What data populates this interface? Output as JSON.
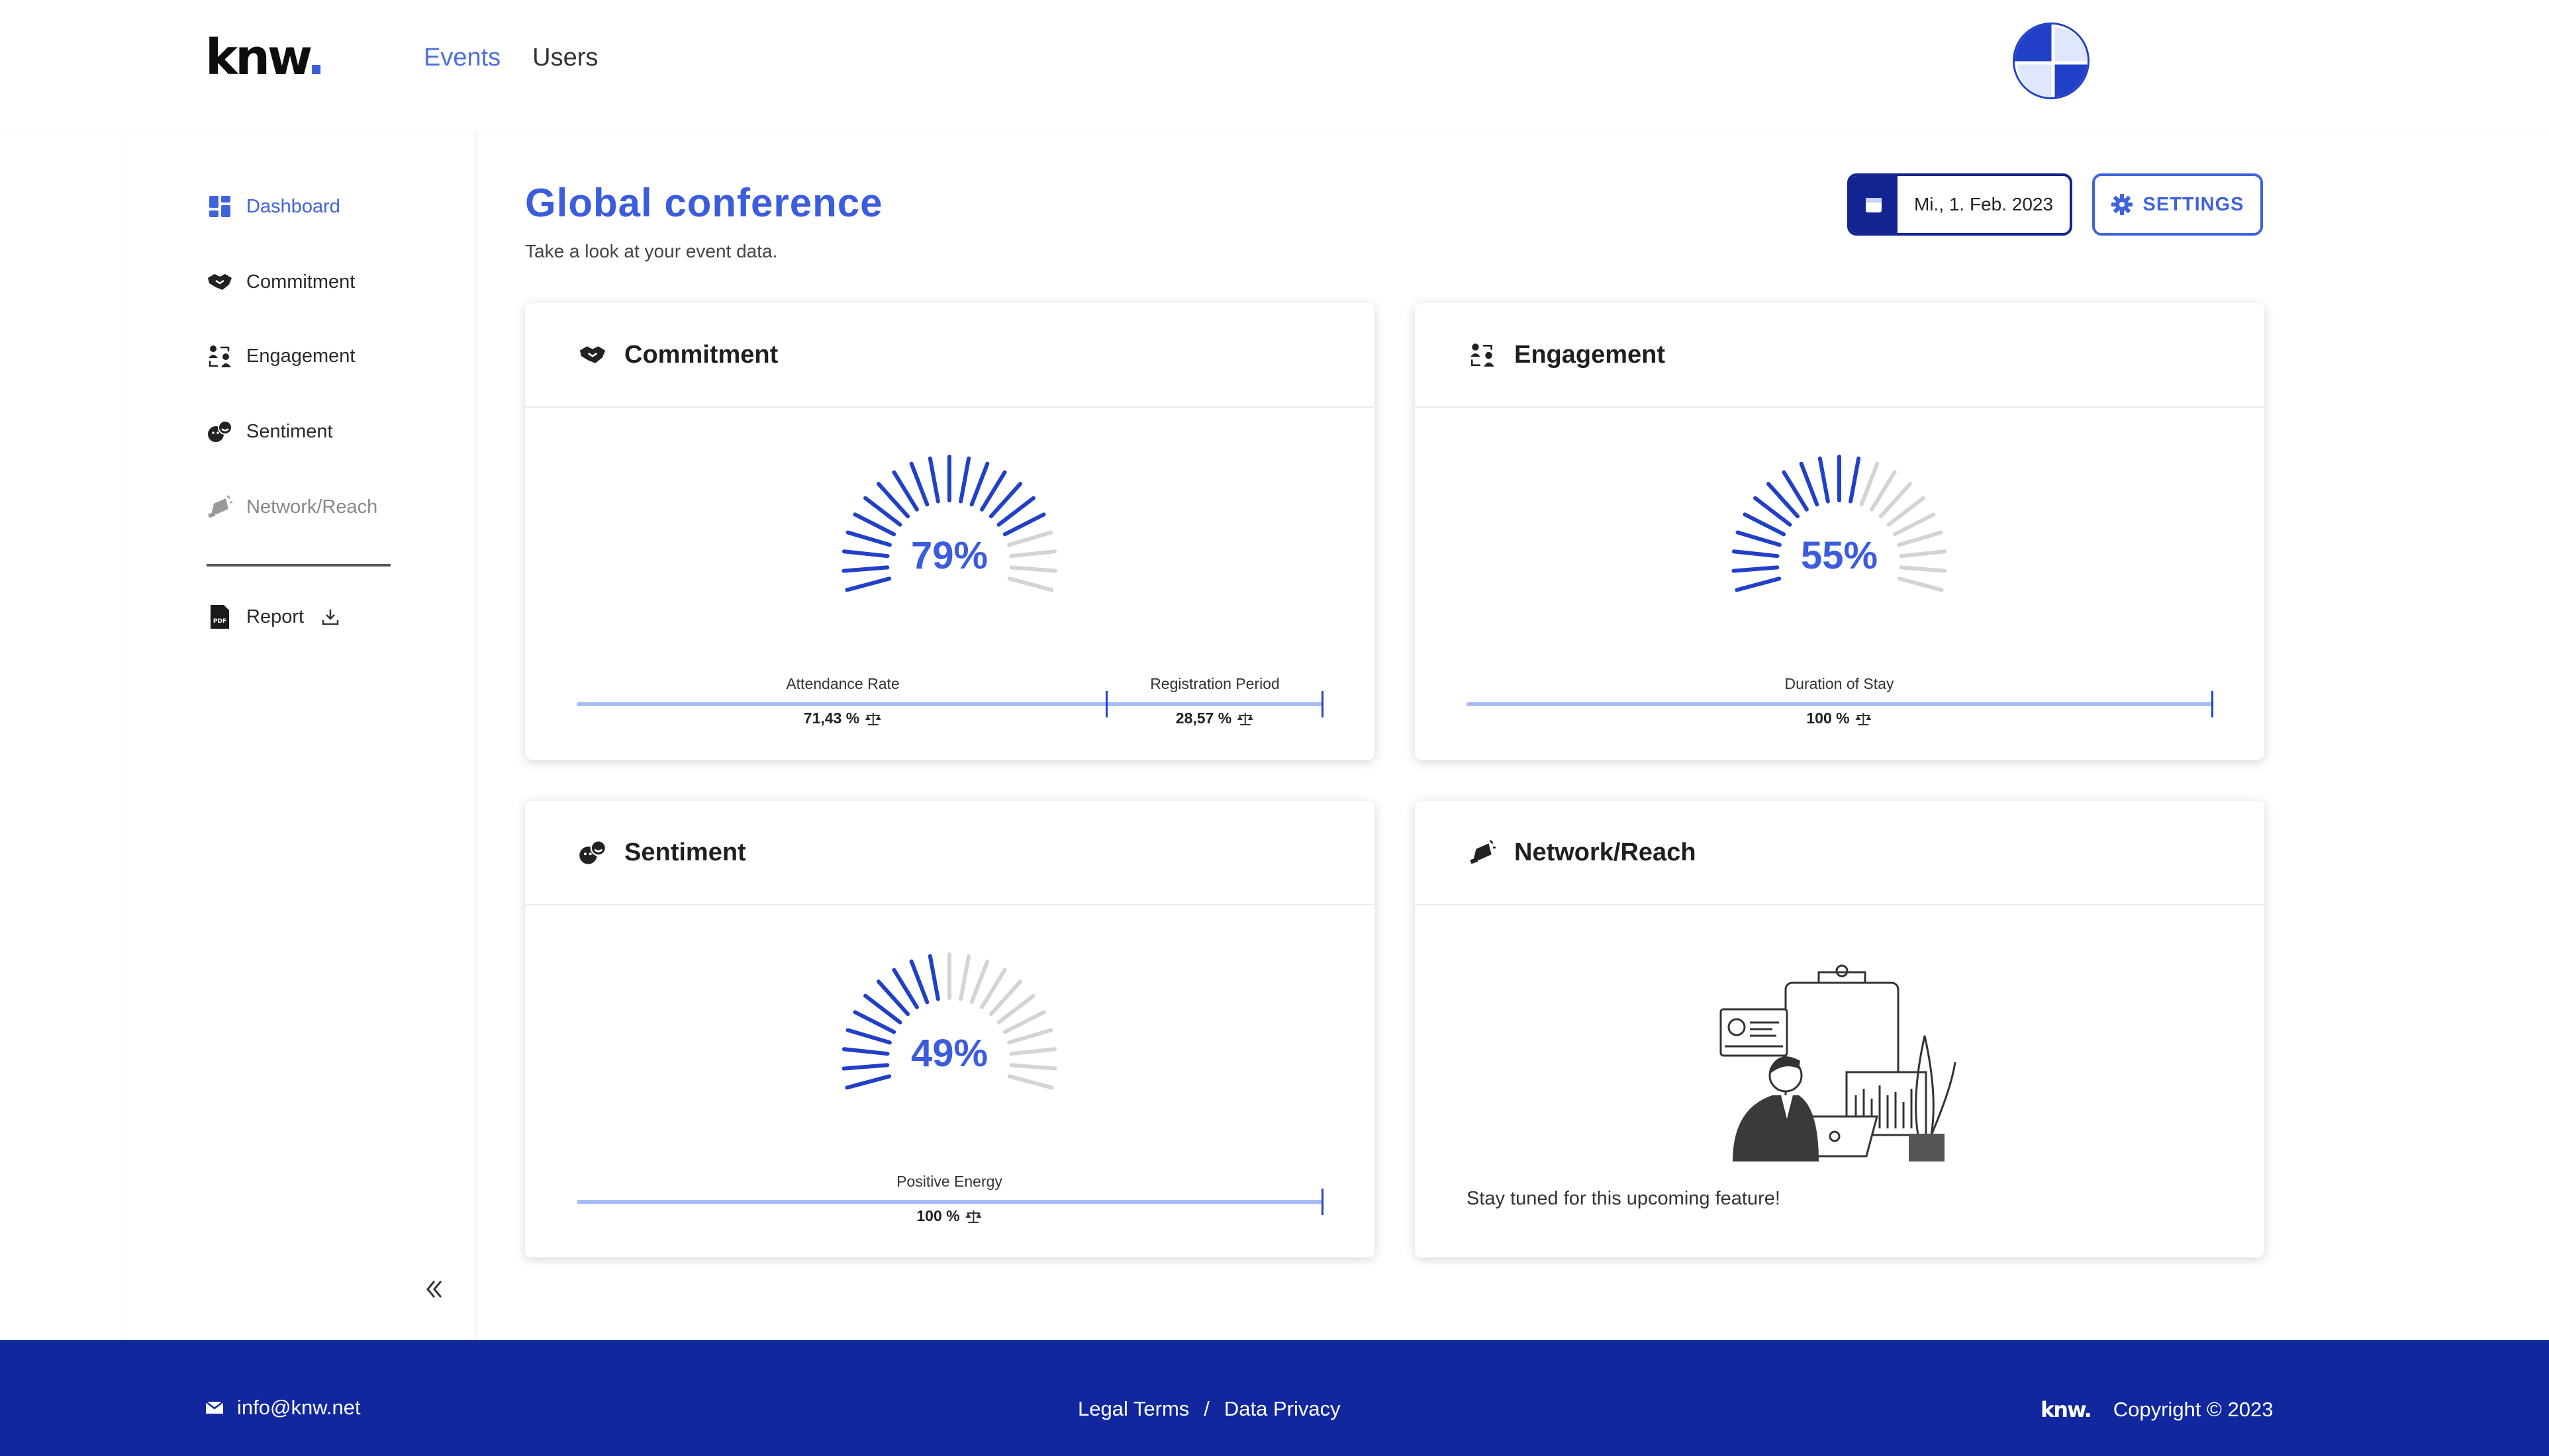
{
  "header": {
    "logo_text": "knw",
    "logo_dot": ".",
    "nav": [
      {
        "label": "Events",
        "active": true
      },
      {
        "label": "Users",
        "active": false
      }
    ],
    "avatar_icon": "user-avatar-pattern"
  },
  "sidebar": {
    "items": [
      {
        "label": "Dashboard",
        "icon": "dashboard-icon",
        "active": true
      },
      {
        "label": "Commitment",
        "icon": "handshake-icon"
      },
      {
        "label": "Engagement",
        "icon": "people-exchange-icon"
      },
      {
        "label": "Sentiment",
        "icon": "sentiment-icon"
      },
      {
        "label": "Network/Reach",
        "icon": "megaphone-icon",
        "disabled": true
      }
    ],
    "report": {
      "label": "Report",
      "icon": "pdf-icon",
      "action_icon": "download-icon"
    },
    "collapse_icon": "double-chevron-left-icon"
  },
  "page": {
    "title": "Global conference",
    "subtitle": "Take a look at your event data.",
    "date_label": "Mi., 1. Feb. 2023",
    "settings_label": "SETTINGS"
  },
  "cards": {
    "commitment": {
      "title": "Commitment",
      "percent": 79,
      "percent_label": "79%",
      "bars": [
        {
          "label": "Attendance Rate",
          "value": "71,43 %",
          "fraction": 0.7143
        },
        {
          "label": "Registration Period",
          "value": "28,57 %",
          "fraction": 0.2857
        }
      ]
    },
    "engagement": {
      "title": "Engagement",
      "percent": 55,
      "percent_label": "55%",
      "bars": [
        {
          "label": "Duration of Stay",
          "value": "100 %",
          "fraction": 1.0
        }
      ]
    },
    "sentiment": {
      "title": "Sentiment",
      "percent": 49,
      "percent_label": "49%",
      "bars": [
        {
          "label": "Positive Energy",
          "value": "100 %",
          "fraction": 1.0
        }
      ]
    },
    "network": {
      "title": "Network/Reach",
      "message": "Stay tuned for this upcoming feature!",
      "illustration": "person-at-laptop-illustration"
    }
  },
  "footer": {
    "email": "info@knw.net",
    "legal": "Legal Terms",
    "separator": "/",
    "privacy": "Data Privacy",
    "logo_text": "knw.",
    "copyright": "Copyright © 2023"
  },
  "colors": {
    "accent": "#3b5cdc",
    "dark_blue": "#10279e",
    "gauge_active": "#2140c8",
    "gauge_inactive": "#d4d4d4"
  }
}
